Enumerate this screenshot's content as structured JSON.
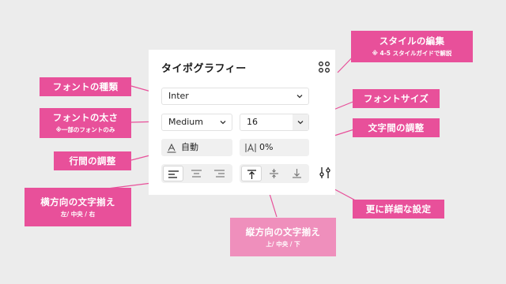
{
  "panel": {
    "title": "タイポグラフィー",
    "font_family": "Inter",
    "font_weight": "Medium",
    "font_size": "16",
    "line_height": "自動",
    "letter_spacing": "0%"
  },
  "callouts": {
    "style_edit": {
      "main": "スタイルの編集",
      "sub": "※ 4-5 スタイルガイドで解説"
    },
    "font_type": {
      "main": "フォントの種類"
    },
    "font_weight": {
      "main": "フォントの太さ",
      "sub": "※一部のフォントのみ"
    },
    "line_height": {
      "main": "行間の調整"
    },
    "h_align": {
      "main": "横方向の文字揃え",
      "sub": "左/ 中央 / 右"
    },
    "font_size": {
      "main": "フォントサイズ"
    },
    "letter_spacing": {
      "main": "文字間の調整"
    },
    "v_align": {
      "main": "縦方向の文字揃え",
      "sub": "上/ 中央 / 下"
    },
    "more_settings": {
      "main": "更に詳細な設定"
    }
  },
  "colors": {
    "callout_dark": "#e8509a",
    "callout_light": "#ef8fbc",
    "connector": "#e8509a",
    "background": "#ececec"
  },
  "icons": {
    "styles": "four-dots-icon",
    "chevron": "chevron-down-icon",
    "line_height": "line-height-icon",
    "letter_spacing": "letter-spacing-icon",
    "align_left": "align-left-icon",
    "align_center": "align-center-icon",
    "align_right": "align-right-icon",
    "align_top": "align-top-icon",
    "align_middle": "align-middle-icon",
    "align_bottom": "align-bottom-icon",
    "more": "sliders-icon"
  }
}
